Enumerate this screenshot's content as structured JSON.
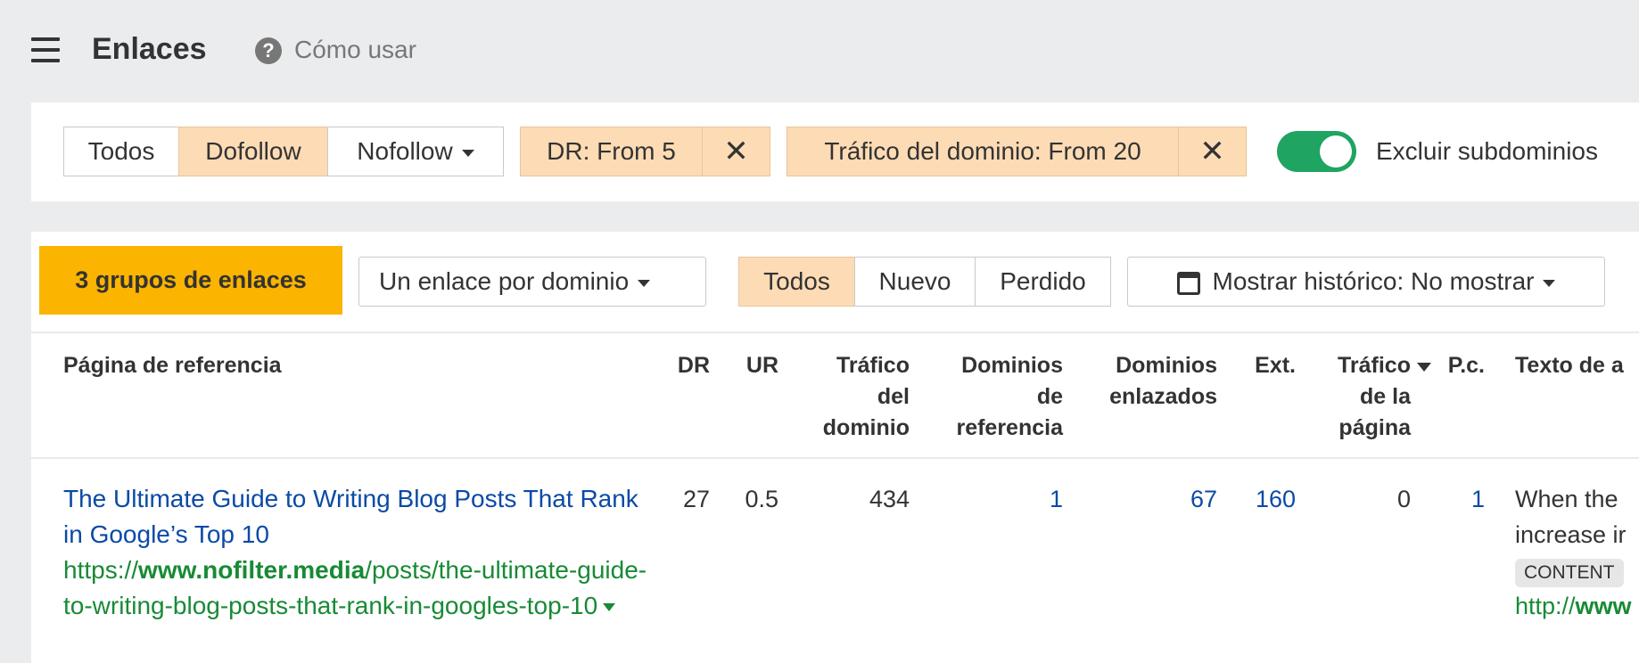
{
  "header": {
    "title": "Enlaces",
    "help_label": "Cómo usar"
  },
  "filters": {
    "link_types": [
      "Todos",
      "Dofollow",
      "Nofollow"
    ],
    "dr_filter": "DR: From 5",
    "traffic_filter": "Tráfico del dominio: From 20",
    "exclude_subdomains_label": "Excluir subdominios",
    "exclude_subdomains_on": true
  },
  "toolbar": {
    "groups_badge": "3 grupos de enlaces",
    "grouping_select": "Un enlace por dominio",
    "status_tabs": [
      "Todos",
      "Nuevo",
      "Perdido"
    ],
    "history_select": "Mostrar histórico: No mostrar"
  },
  "table": {
    "headers": {
      "page": "Página de referencia",
      "dr": "DR",
      "ur": "UR",
      "domain_traffic": "Tráfico del dominio",
      "ref_domains": "Dominios de referencia",
      "linked_domains": "Dominios enlazados",
      "ext": "Ext.",
      "page_traffic": "Tráfico de la página",
      "pc": "P.c.",
      "anchor": "Texto de a"
    },
    "rows": [
      {
        "title": "The Ultimate Guide to Writing Blog Posts That Rank in Google’s Top 10",
        "url_prefix": "https://",
        "url_domain": "www.nofilter.media",
        "url_path": "/posts/the-ultimate-guide-to-writing-blog-posts-that-rank-in-googles-top-10",
        "dr": "27",
        "ur": "0.5",
        "domain_traffic": "434",
        "ref_domains": "1",
        "linked_domains": "67",
        "ext": "160",
        "page_traffic": "0",
        "pc": "1",
        "anchor_text": "When the increase ir",
        "anchor_tag": "CONTENT",
        "anchor_url_prefix": "http://",
        "anchor_url_domain": "www"
      }
    ]
  },
  "colors": {
    "accent": "#fbb400",
    "selected": "#fddcb5",
    "toggle": "#1fa462",
    "link": "#0b4aa6",
    "url": "#188a35"
  }
}
